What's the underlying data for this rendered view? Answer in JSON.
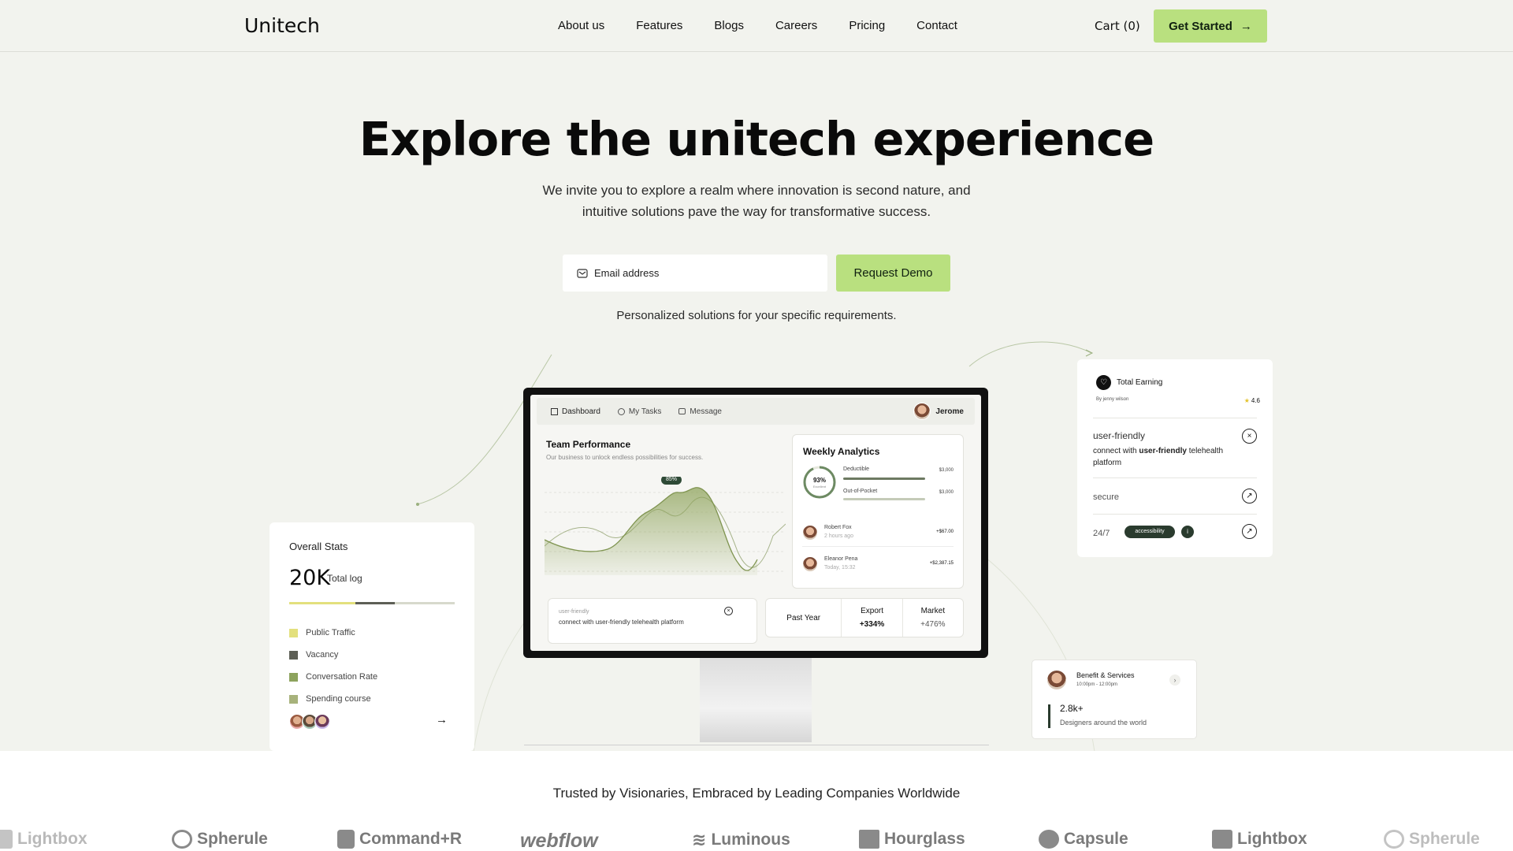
{
  "nav": {
    "logo": "Unitech",
    "links": [
      "About us",
      "Features",
      "Blogs",
      "Careers",
      "Pricing",
      "Contact"
    ],
    "cart": "Cart (0)",
    "cta": "Get Started"
  },
  "hero": {
    "title": "Explore the unitech experience",
    "subtitle_1": "We invite you to explore a realm where innovation is second nature, and",
    "subtitle_2": "intuitive solutions pave the way for transformative success.",
    "email_placeholder": "Email address",
    "demo_button": "Request Demo",
    "note": "Personalized solutions for your specific requirements."
  },
  "dashboard": {
    "tabs": [
      "Dashboard",
      "My Tasks",
      "Message"
    ],
    "user": "Jerome",
    "team_title": "Team Performance",
    "team_sub": "Our business to unlock endless possibilities for success.",
    "peak_label": "85%",
    "weekly_title": "Weekly Analytics",
    "gauge_value": "93%",
    "gauge_label": "Excellent",
    "deductible": "Deductible",
    "deductible_val": "$3,000",
    "oop": "Out-of-Pocket",
    "oop_val": "$3,000",
    "people": [
      {
        "name": "Robert Fox",
        "time": "2 hours ago",
        "amount": "+$67.00"
      },
      {
        "name": "Eleanor Pena",
        "time": "Today, 15:32",
        "amount": "+$2,387.15"
      }
    ],
    "card1_small": "user-friendly",
    "card1_text": "connect with user-friendly telehealth platform",
    "period": "Past Year",
    "export_label": "Export",
    "export_val": "+334%",
    "market_label": "Market",
    "market_val": "+476%"
  },
  "stats": {
    "title": "Overall Stats",
    "value": "20K",
    "value_label": "Total log",
    "legend": [
      {
        "label": "Public Traffic",
        "color": "#e3e07d"
      },
      {
        "label": "Vacancy",
        "color": "#5d5f55"
      },
      {
        "label": "Conversation Rate",
        "color": "#8da35d"
      },
      {
        "label": "Spending course",
        "color": "#a7b27b"
      }
    ]
  },
  "earning": {
    "title": "Total Earning",
    "by": "By jenny wilson",
    "rating": "4.6",
    "item1_title": "user-friendly",
    "item1_text_a": "connect with ",
    "item1_text_b": "user-friendly",
    "item1_text_c": " telehealth",
    "item1_text_d": "platform",
    "item2": "secure",
    "item3": "24/7",
    "badge": "accessibility"
  },
  "benefit": {
    "title": "Benefit & Services",
    "time": "10:00pm - 12:00pm",
    "value": "2.8k+",
    "desc": "Designers around the world"
  },
  "trusted": {
    "title": "Trusted by Visionaries, Embraced by Leading Companies Worldwide",
    "logos": [
      "Lightbox",
      "Spherule",
      "Command+R",
      "webflow",
      "Luminous",
      "Hourglass",
      "Capsule",
      "Lightbox",
      "Spherule"
    ]
  },
  "colors": {
    "accent": "#b9e07f",
    "bg": "#f2f3ee",
    "dark_green": "#2a3b2e"
  }
}
